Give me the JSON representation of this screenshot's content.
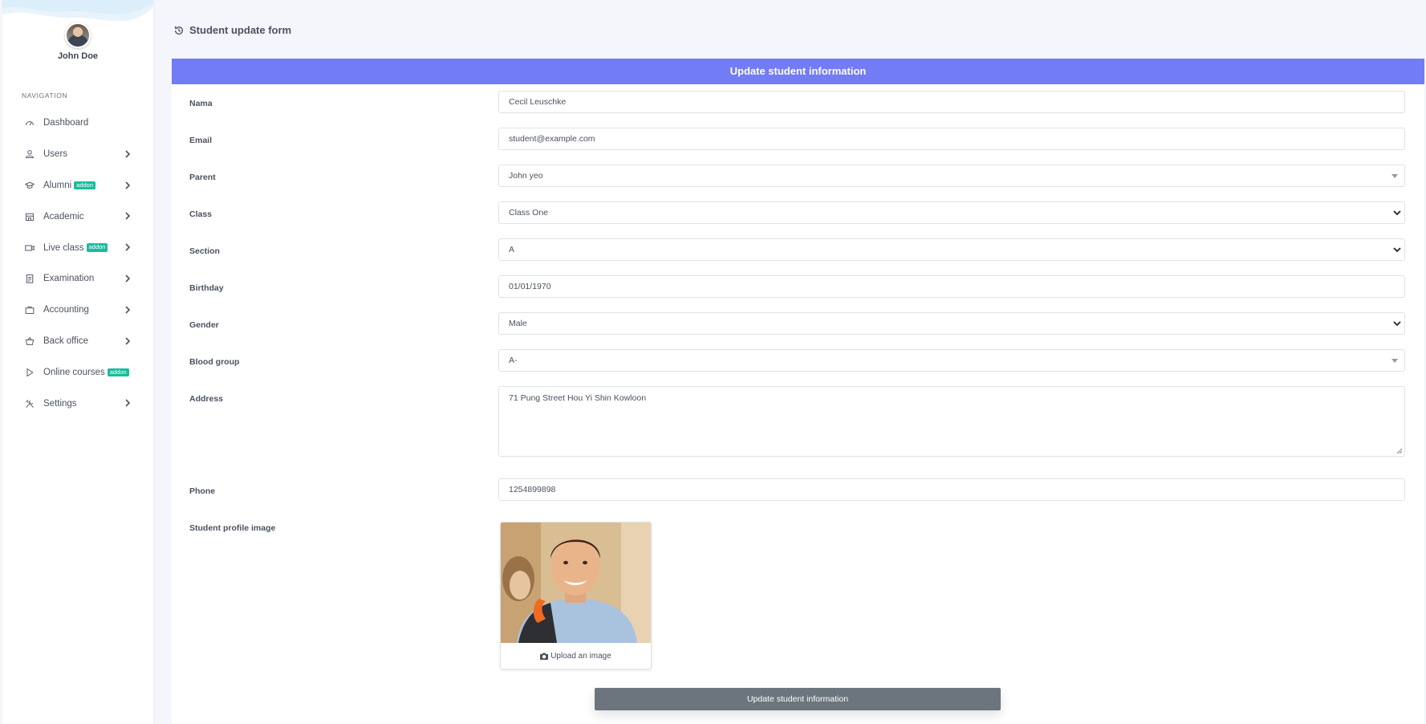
{
  "user": {
    "name": "John Doe"
  },
  "sidebar": {
    "heading": "NAVIGATION",
    "items": [
      {
        "label": "Dashboard",
        "icon": "dashboard-icon",
        "badge": "",
        "chevron": false
      },
      {
        "label": "Users",
        "icon": "user-icon",
        "badge": "",
        "chevron": true
      },
      {
        "label": "Alumni",
        "icon": "graduation-cap-icon",
        "badge": "addon",
        "chevron": true
      },
      {
        "label": "Academic",
        "icon": "school-icon",
        "badge": "",
        "chevron": true
      },
      {
        "label": "Live class",
        "icon": "video-icon",
        "badge": "addon",
        "chevron": true
      },
      {
        "label": "Examination",
        "icon": "clipboard-icon",
        "badge": "",
        "chevron": true
      },
      {
        "label": "Accounting",
        "icon": "briefcase-icon",
        "badge": "",
        "chevron": true
      },
      {
        "label": "Back office",
        "icon": "basket-icon",
        "badge": "",
        "chevron": true
      },
      {
        "label": "Online courses",
        "icon": "play-icon",
        "badge": "addon",
        "chevron": false
      },
      {
        "label": "Settings",
        "icon": "tools-icon",
        "badge": "",
        "chevron": true
      }
    ]
  },
  "page": {
    "title": "Student update form"
  },
  "form": {
    "header": "Update student information",
    "fields": {
      "name": {
        "label": "Nama",
        "value": "Cecil Leuschke"
      },
      "email": {
        "label": "Email",
        "value": "student@example.com"
      },
      "parent": {
        "label": "Parent",
        "value": "John yeo"
      },
      "class": {
        "label": "Class",
        "value": "Class One"
      },
      "section": {
        "label": "Section",
        "value": "A"
      },
      "birthday": {
        "label": "Birthday",
        "value": "01/01/1970"
      },
      "gender": {
        "label": "Gender",
        "value": "Male"
      },
      "blood_group": {
        "label": "Blood group",
        "value": "A-"
      },
      "address": {
        "label": "Address",
        "value": "71 Pung Street Hou Yi Shin Kowloon"
      },
      "phone": {
        "label": "Phone",
        "value": "1254899898"
      },
      "profile_image": {
        "label": "Student profile image",
        "upload_label": "Upload an image"
      }
    },
    "submit_label": "Update student information"
  },
  "colors": {
    "accent": "#727cf5",
    "badge": "#1abc9c",
    "submit": "#6c757d"
  }
}
